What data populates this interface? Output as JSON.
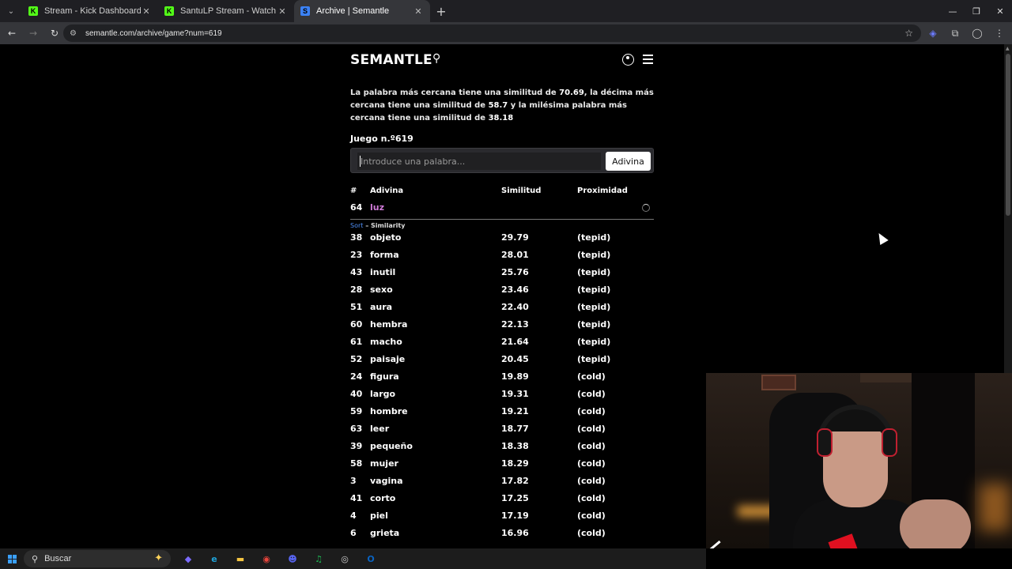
{
  "browser": {
    "tabs": [
      {
        "title": "Stream - Kick Dashboard",
        "favicon": "K",
        "favicon_color": "#53fc18",
        "active": false
      },
      {
        "title": "SantuLP Stream - Watch Live on",
        "favicon": "K",
        "favicon_color": "#53fc18",
        "active": false
      },
      {
        "title": "Archive | Semantle",
        "favicon": "S",
        "favicon_color": "#3b82f6",
        "active": true
      }
    ],
    "url": "semantle.com/archive/game?num=619"
  },
  "semantle": {
    "logo": "SEMANTLE",
    "intro": {
      "p1": "La palabra más cercana tiene una similitud de ",
      "v1": "70.69",
      "p2": ", la décima más cercana tiene una similitud de ",
      "v2": "58.7",
      "p3": " y la milésima palabra más cercana tiene una similitud de ",
      "v3": "38.18"
    },
    "game_label": "Juego n.º619",
    "input_placeholder": "Introduce una palabra...",
    "guess_button": "Adivina",
    "columns": {
      "num": "#",
      "word": "Adivina",
      "similarity": "Similitud",
      "proximity": "Proximidad"
    },
    "latest": {
      "num": "64",
      "word": "luz"
    },
    "sort": {
      "link": "Sort",
      "label": "– Similarity"
    },
    "rows": [
      {
        "num": "38",
        "word": "objeto",
        "sim": "29.79",
        "prox": "(tepid)"
      },
      {
        "num": "23",
        "word": "forma",
        "sim": "28.01",
        "prox": "(tepid)"
      },
      {
        "num": "43",
        "word": "inutil",
        "sim": "25.76",
        "prox": "(tepid)"
      },
      {
        "num": "28",
        "word": "sexo",
        "sim": "23.46",
        "prox": "(tepid)"
      },
      {
        "num": "51",
        "word": "aura",
        "sim": "22.40",
        "prox": "(tepid)"
      },
      {
        "num": "60",
        "word": "hembra",
        "sim": "22.13",
        "prox": "(tepid)"
      },
      {
        "num": "61",
        "word": "macho",
        "sim": "21.64",
        "prox": "(tepid)"
      },
      {
        "num": "52",
        "word": "paisaje",
        "sim": "20.45",
        "prox": "(tepid)"
      },
      {
        "num": "24",
        "word": "figura",
        "sim": "19.89",
        "prox": "(cold)"
      },
      {
        "num": "40",
        "word": "largo",
        "sim": "19.31",
        "prox": "(cold)"
      },
      {
        "num": "59",
        "word": "hombre",
        "sim": "19.21",
        "prox": "(cold)"
      },
      {
        "num": "63",
        "word": "leer",
        "sim": "18.77",
        "prox": "(cold)"
      },
      {
        "num": "39",
        "word": "pequeño",
        "sim": "18.38",
        "prox": "(cold)"
      },
      {
        "num": "58",
        "word": "mujer",
        "sim": "18.29",
        "prox": "(cold)"
      },
      {
        "num": "3",
        "word": "vagina",
        "sim": "17.82",
        "prox": "(cold)"
      },
      {
        "num": "41",
        "word": "corto",
        "sim": "17.25",
        "prox": "(cold)"
      },
      {
        "num": "4",
        "word": "piel",
        "sim": "17.19",
        "prox": "(cold)"
      },
      {
        "num": "6",
        "word": "grieta",
        "sim": "16.96",
        "prox": "(cold)"
      }
    ]
  },
  "taskbar": {
    "search_label": "Buscar",
    "apps": [
      {
        "name": "copilot",
        "glyph": "◆",
        "color": "#7b6cff"
      },
      {
        "name": "edge",
        "glyph": "e",
        "color": "#1fa3d9"
      },
      {
        "name": "file-explorer",
        "glyph": "▬",
        "color": "#f5c542"
      },
      {
        "name": "chrome",
        "glyph": "◉",
        "color": "#e8453c"
      },
      {
        "name": "discord",
        "glyph": "☻",
        "color": "#5865f2"
      },
      {
        "name": "spotify",
        "glyph": "♫",
        "color": "#1db954"
      },
      {
        "name": "obs",
        "glyph": "◎",
        "color": "#cccccc"
      },
      {
        "name": "outlook",
        "glyph": "O",
        "color": "#0a64c2"
      }
    ]
  }
}
